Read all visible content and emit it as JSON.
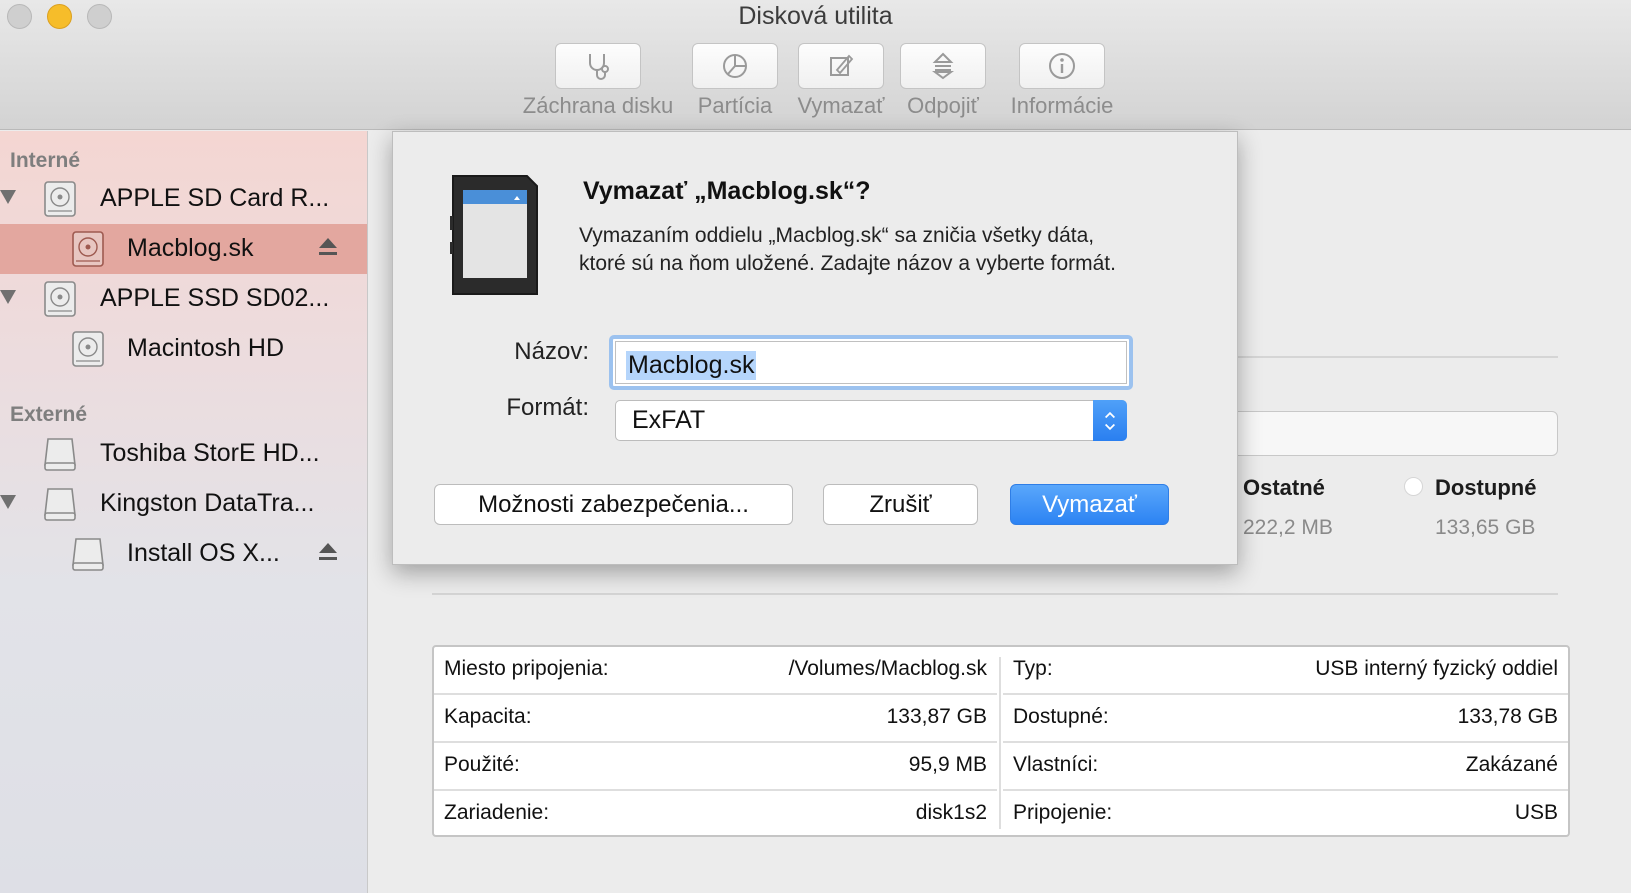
{
  "window": {
    "title": "Disková utilita"
  },
  "toolbar": {
    "items": [
      {
        "label": "Záchrana disku",
        "icon": "stethoscope-icon"
      },
      {
        "label": "Partícia",
        "icon": "pie-chart-icon"
      },
      {
        "label": "Vymazať",
        "icon": "erase-icon"
      },
      {
        "label": "Odpojiť",
        "icon": "unmount-icon"
      },
      {
        "label": "Informácie",
        "icon": "info-icon"
      }
    ]
  },
  "sidebar": {
    "internal_header": "Interné",
    "external_header": "Externé",
    "items": [
      {
        "label": "APPLE SD Card R...",
        "icon": "internal-disk-icon"
      },
      {
        "label": "Macblog.sk",
        "icon": "volume-icon",
        "selected": true
      },
      {
        "label": "APPLE SSD SD02...",
        "icon": "internal-disk-icon"
      },
      {
        "label": "Macintosh HD",
        "icon": "volume-icon"
      },
      {
        "label": "Toshiba StorE HD...",
        "icon": "external-disk-icon"
      },
      {
        "label": "Kingston DataTra...",
        "icon": "external-disk-icon"
      },
      {
        "label": "Install OS X...",
        "icon": "external-volume-icon"
      }
    ]
  },
  "usage": {
    "ostatne_label": "Ostatné",
    "ostatne_value": "222,2 MB",
    "dostupne_label": "Dostupné",
    "dostupne_value": "133,65 GB"
  },
  "info": {
    "left": [
      {
        "key": "Miesto pripojenia:",
        "value": "/Volumes/Macblog.sk"
      },
      {
        "key": "Kapacita:",
        "value": "133,87 GB"
      },
      {
        "key": "Použité:",
        "value": "95,9 MB"
      },
      {
        "key": "Zariadenie:",
        "value": "disk1s2"
      }
    ],
    "right": [
      {
        "key": "Typ:",
        "value": "USB interný fyzický oddiel"
      },
      {
        "key": "Dostupné:",
        "value": "133,78 GB"
      },
      {
        "key": "Vlastníci:",
        "value": "Zakázané"
      },
      {
        "key": "Pripojenie:",
        "value": "USB"
      }
    ]
  },
  "dialog": {
    "title": "Vymazať „Macblog.sk“?",
    "message_line1": "Vymazaním oddielu „Macblog.sk“ sa zničia všetky dáta,",
    "message_line2": "ktoré sú na ňom uložené. Zadajte názov a vyberte formát.",
    "name_label": "Názov:",
    "name_value": "Macblog.sk",
    "format_label": "Formát:",
    "format_value": "ExFAT",
    "security_button": "Možnosti zabezpečenia...",
    "cancel_button": "Zrušiť",
    "erase_button": "Vymazať"
  },
  "colors": {
    "accent": "#2c83f3",
    "selection": "#e3a79f",
    "focus_ring": "#9cc2ef"
  }
}
